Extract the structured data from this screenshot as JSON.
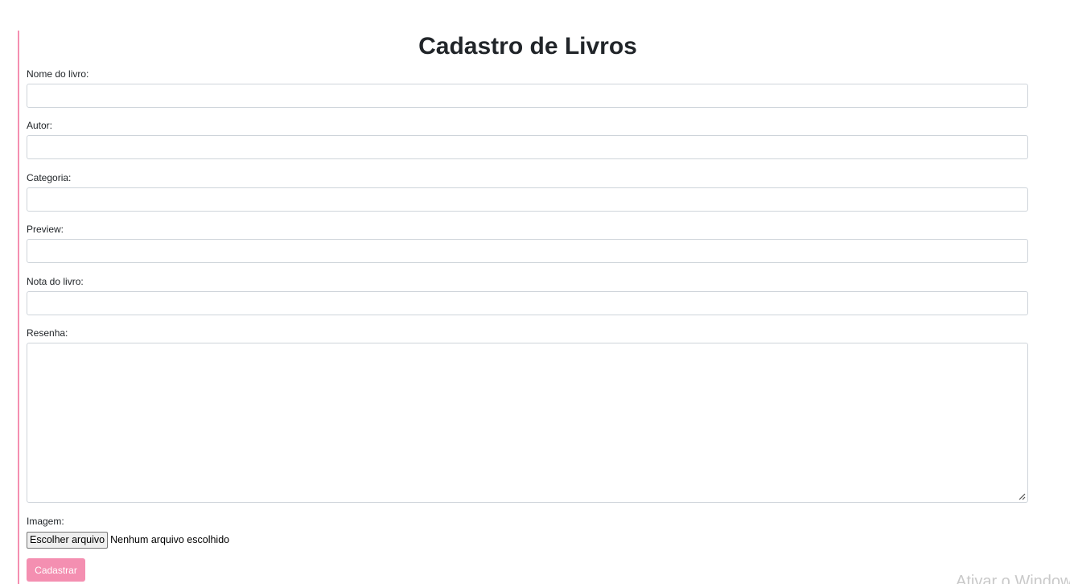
{
  "page": {
    "title": "Cadastro de Livros"
  },
  "form": {
    "fields": [
      {
        "label": "Nome do livro:",
        "value": ""
      },
      {
        "label": "Autor:",
        "value": ""
      },
      {
        "label": "Categoria:",
        "value": ""
      },
      {
        "label": "Preview:",
        "value": ""
      },
      {
        "label": "Nota do livro:",
        "value": ""
      },
      {
        "label": "Resenha:",
        "value": ""
      }
    ],
    "image": {
      "label": "Imagem:",
      "button_label": "Escolher arquivo",
      "status": "Nenhum arquivo escolhido"
    },
    "submit_label": "Cadastrar"
  },
  "overlay": {
    "watermark": "Ativar o Windows"
  },
  "colors": {
    "accent": "#f48fb1",
    "text": "#212529",
    "input_border": "#ced4da"
  }
}
